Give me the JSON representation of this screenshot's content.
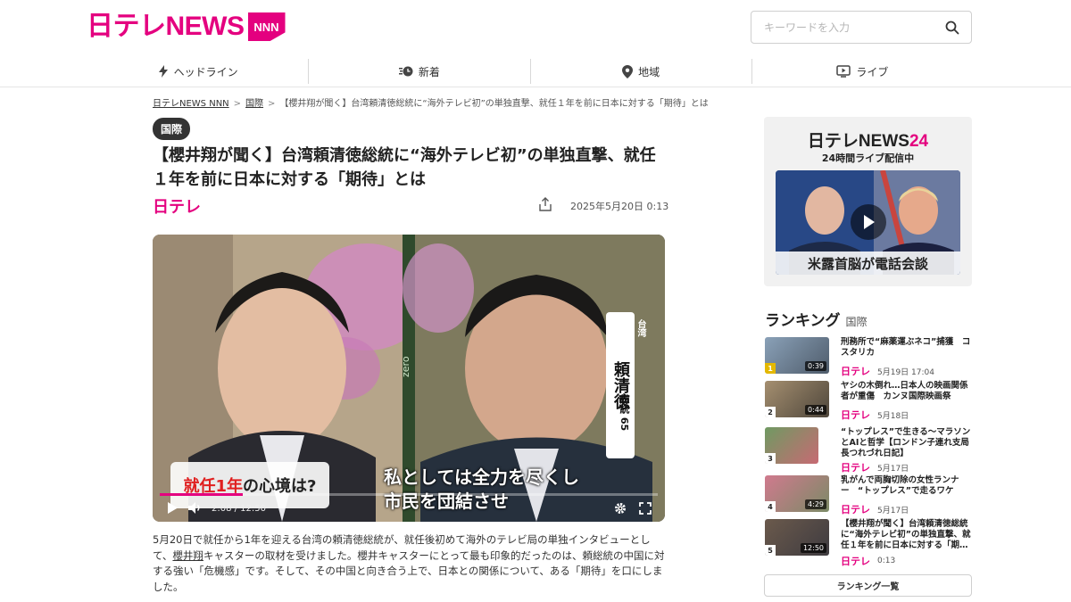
{
  "header": {
    "logo_text": "日テレNEWS",
    "logo_badge": "NNN",
    "search_placeholder": "キーワードを入力"
  },
  "nav": {
    "items": [
      {
        "label": "ヘッドライン",
        "icon": "lightning-icon"
      },
      {
        "label": "新着",
        "icon": "clock-icon"
      },
      {
        "label": "地域",
        "icon": "map-pin-icon"
      },
      {
        "label": "ライブ",
        "icon": "live-tv-icon"
      }
    ]
  },
  "breadcrumb": {
    "home": "日テレNEWS NNN",
    "category": "国際",
    "current": "【櫻井翔が聞く】台湾頼清徳総統に“海外テレビ初”の単独直撃、就任１年を前に日本に対する「期待」とは"
  },
  "article": {
    "category_badge": "国際",
    "title": "【櫻井翔が聞く】台湾頼清徳総統に“海外テレビ初”の単独直撃、就任１年を前に日本に対する「期待」とは",
    "source": "日テレ",
    "date": "2025年5月20日 0:13",
    "video": {
      "name_card": "頼清徳",
      "name_age": "総統 65",
      "name_region": "台湾",
      "station_mark": "zero",
      "question_prefix": "就任1年",
      "question_suffix": "の心境は?",
      "subtitle_line1": "私としては全力を尽くし",
      "subtitle_line2": "市民を団結させ",
      "time": "2:08 / 12:50",
      "progress": 0.166
    },
    "body_prefix": "5月20日で就任から1年を迎える台湾の頼清徳総統が、就任後初めて海外のテレビ局の単独インタビューとして、",
    "body_link": "櫻井翔",
    "body_suffix": "キャスターの取材を受けました。櫻井キャスターにとって最も印象的だったのは、頼総統の中国に対する強い「危機感」です。そして、その中国と向き合う上で、日本との関係について、ある「期待」を口にしました。"
  },
  "sidebar": {
    "live": {
      "logo_prefix": "日テレNEWS",
      "logo_num": "24",
      "subtitle": "24時間ライブ配信中",
      "caption": "米露首脳が電話会談"
    },
    "ranking": {
      "title": "ランキング",
      "category": "国際",
      "more_label": "ランキング一覧",
      "items": [
        {
          "rank": "1",
          "title": "刑務所で“麻薬運ぶネコ”捕獲　コスタリカ",
          "source": "日テレ",
          "date": "5月19日 17:04",
          "duration": "0:39"
        },
        {
          "rank": "2",
          "title": "ヤシの木倒れ…日本人の映画関係者が重傷　カンヌ国際映画祭",
          "source": "日テレ",
          "date": "5月18日",
          "duration": "0:44"
        },
        {
          "rank": "3",
          "title": "“トップレス”で生きる～マラソンとAIと哲学【ロンドン子連れ支局長つれづれ日記】",
          "source": "日テレ",
          "date": "5月17日",
          "duration": ""
        },
        {
          "rank": "4",
          "title": "乳がんで両胸切除の女性ランナー　“トップレス”で走るワケ",
          "source": "日テレ",
          "date": "5月17日",
          "duration": "4:29"
        },
        {
          "rank": "5",
          "title": "【櫻井翔が聞く】台湾頼清徳総統に“海外テレビ初”の単独直撃、就任１年を前に日本に対する「期…",
          "source": "日テレ",
          "date": "0:13",
          "duration": "12:50"
        }
      ]
    }
  }
}
